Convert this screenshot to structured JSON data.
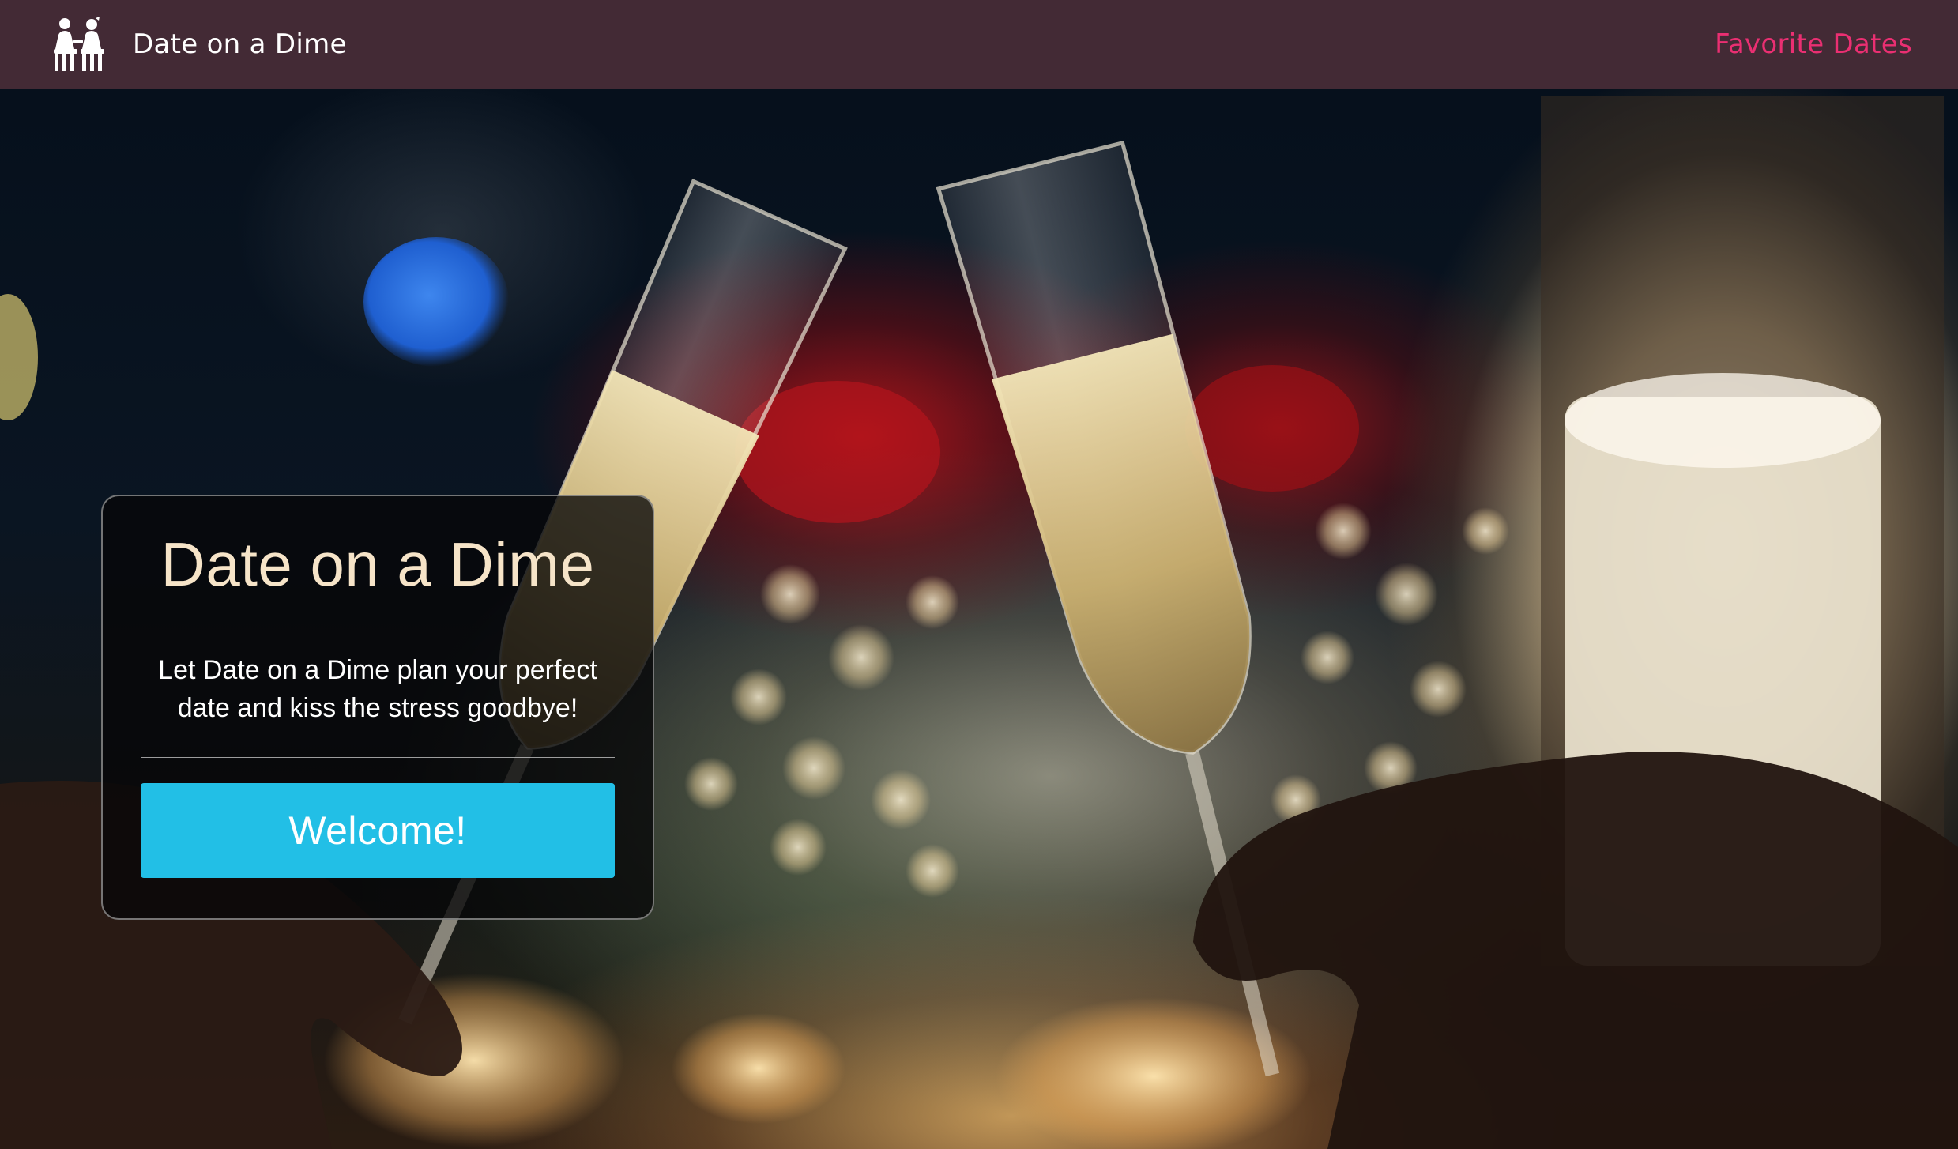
{
  "navbar": {
    "brand_icon": "couple-icon",
    "brand_label": "Date on a Dime",
    "favorites_link": "Favorite Dates",
    "colors": {
      "background": "#432a35",
      "brand_text": "#ffffff",
      "link": "#ea2f72"
    }
  },
  "hero": {
    "background_image": "champagne-toast-photo",
    "card": {
      "title": "Date on a Dime",
      "description": "Let Date on a Dime plan your perfect date and kiss the stress goodbye!",
      "button_label": "Welcome!",
      "colors": {
        "title": "#f6e4c8",
        "button": "#22bfe6"
      }
    }
  }
}
